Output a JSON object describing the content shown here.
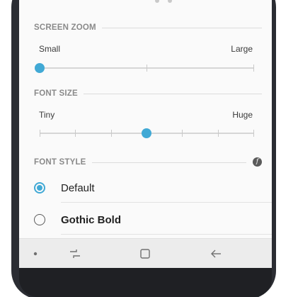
{
  "screen_zoom": {
    "header": "SCREEN ZOOM",
    "min_label": "Small",
    "max_label": "Large",
    "level_index": 0,
    "level_count": 3
  },
  "font_size": {
    "header": "FONT SIZE",
    "min_label": "Tiny",
    "max_label": "Huge",
    "level_index": 3,
    "level_count": 7
  },
  "font_style": {
    "header": "FONT STYLE",
    "info_icon": "info-icon",
    "options": [
      {
        "label": "Default",
        "selected": true
      },
      {
        "label": "Gothic Bold",
        "selected": false
      }
    ]
  },
  "navbar": {
    "icons": [
      "dot-icon",
      "recents-icon",
      "home-icon",
      "back-icon"
    ]
  },
  "colors": {
    "accent": "#41a9d5",
    "background": "#fafafa",
    "frame": "#2b2d33"
  }
}
